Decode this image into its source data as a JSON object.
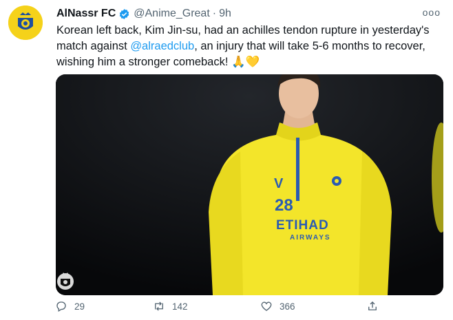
{
  "tweet": {
    "author_name": "AlNassr FC",
    "author_handle": "@Anime_Great",
    "separator": "·",
    "time": "9h",
    "more_label": "ooo",
    "text_part1": "Korean left back, Kim Jin-su, had an achilles tendon rupture in yesterday's match against ",
    "mention": "@alraedclub",
    "text_part2": ", an injury that will take 5-6 months to recover, wishing him a stronger comeback! 🙏💛",
    "photo": {
      "jersey_number": "28",
      "jersey_letter": "V",
      "sponsor_main": "ETIHAD",
      "sponsor_sub": "AIRWAYS"
    },
    "actions": {
      "replies": "29",
      "retweets": "142",
      "likes": "366"
    }
  },
  "colors": {
    "link": "#1d9bf0",
    "muted": "#536471",
    "jersey_yellow": "#f3e52a",
    "jersey_blue": "#2a5bb3"
  },
  "icons": [
    "verified-badge-icon",
    "more-options-icon",
    "reply-icon",
    "retweet-icon",
    "like-icon",
    "share-icon",
    "club-crest-icon"
  ]
}
